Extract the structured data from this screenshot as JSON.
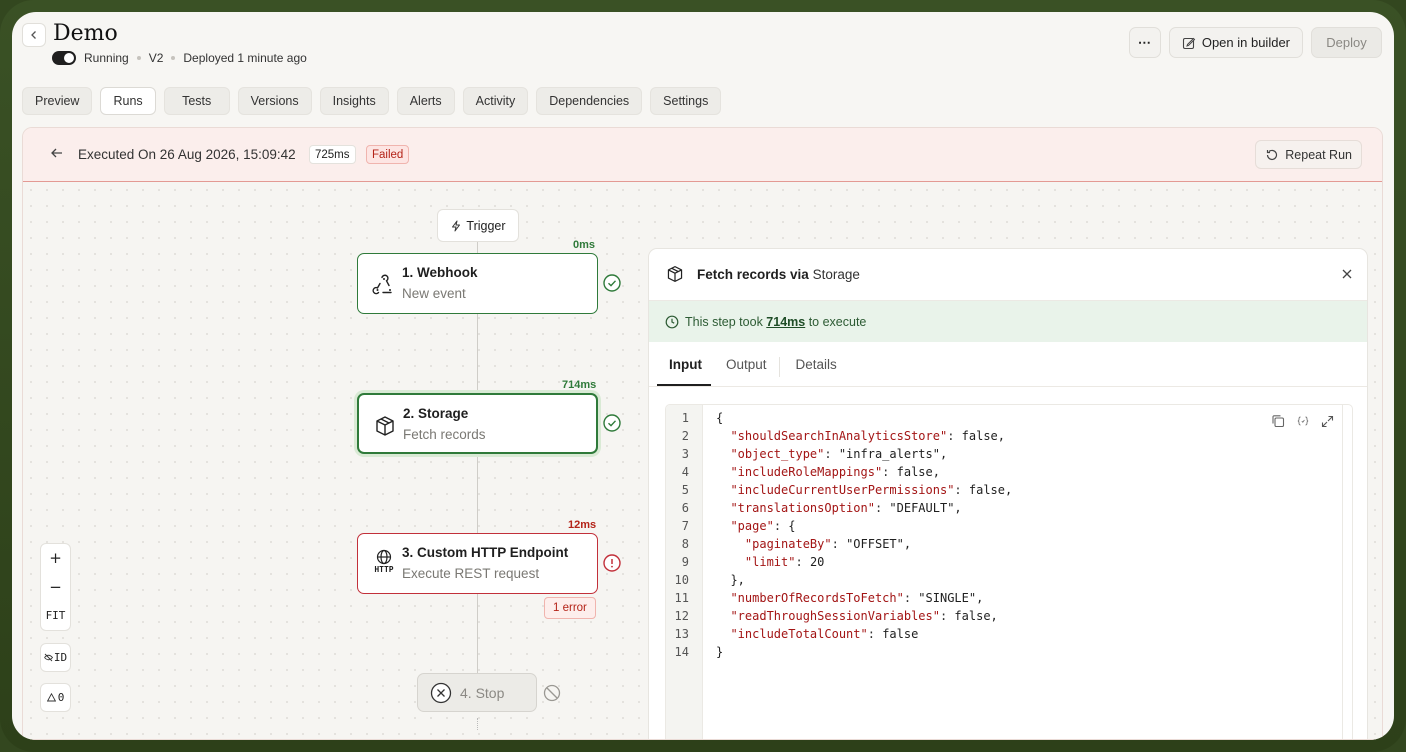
{
  "header": {
    "title": "Demo",
    "status": "Running",
    "version": "V2",
    "deployed": "Deployed 1 minute ago",
    "open_builder": "Open in builder",
    "deploy": "Deploy",
    "more": "⋯"
  },
  "tabs": [
    "Preview",
    "Runs",
    "Tests",
    "Versions",
    "Insights",
    "Alerts",
    "Activity",
    "Dependencies",
    "Settings"
  ],
  "run": {
    "executed": "Executed On 26 Aug 2026, 15:09:42",
    "duration": "725ms",
    "status": "Failed",
    "repeat": "Repeat Run"
  },
  "flow": {
    "trigger": "Trigger",
    "nodes": [
      {
        "title": "1. Webhook",
        "subtitle": "New event",
        "duration": "0ms"
      },
      {
        "title": "2. Storage",
        "subtitle": "Fetch records",
        "duration": "714ms"
      },
      {
        "title": "3. Custom HTTP Endpoint",
        "subtitle": "Execute REST request",
        "duration": "12ms",
        "error_chip": "1 error",
        "icon_label": "HTTP"
      }
    ],
    "stop": "4. Stop"
  },
  "zoom": {
    "plus": "+",
    "minus": "−",
    "fit": "FIT",
    "id": "ID",
    "warn": "0"
  },
  "panel": {
    "title_prefix": "Fetch records via ",
    "title_service": "Storage",
    "took_prefix": "This step took ",
    "took_value": "714ms",
    "took_suffix": " to execute",
    "tabs": [
      "Input",
      "Output",
      "Details"
    ],
    "code_lines": [
      "{",
      "  \"shouldSearchInAnalyticsStore\": false,",
      "  \"object_type\": \"infra_alerts\",",
      "  \"includeRoleMappings\": false,",
      "  \"includeCurrentUserPermissions\": false,",
      "  \"translationsOption\": \"DEFAULT\",",
      "  \"page\": {",
      "    \"paginateBy\": \"OFFSET\",",
      "    \"limit\": 20",
      "  },",
      "  \"numberOfRecordsToFetch\": \"SINGLE\",",
      "  \"readThroughSessionVariables\": false,",
      "  \"includeTotalCount\": false",
      "}"
    ]
  },
  "colors": {
    "success": "#2f7a3a",
    "error": "#b42318",
    "accent_bg": "#e9f3ea"
  }
}
